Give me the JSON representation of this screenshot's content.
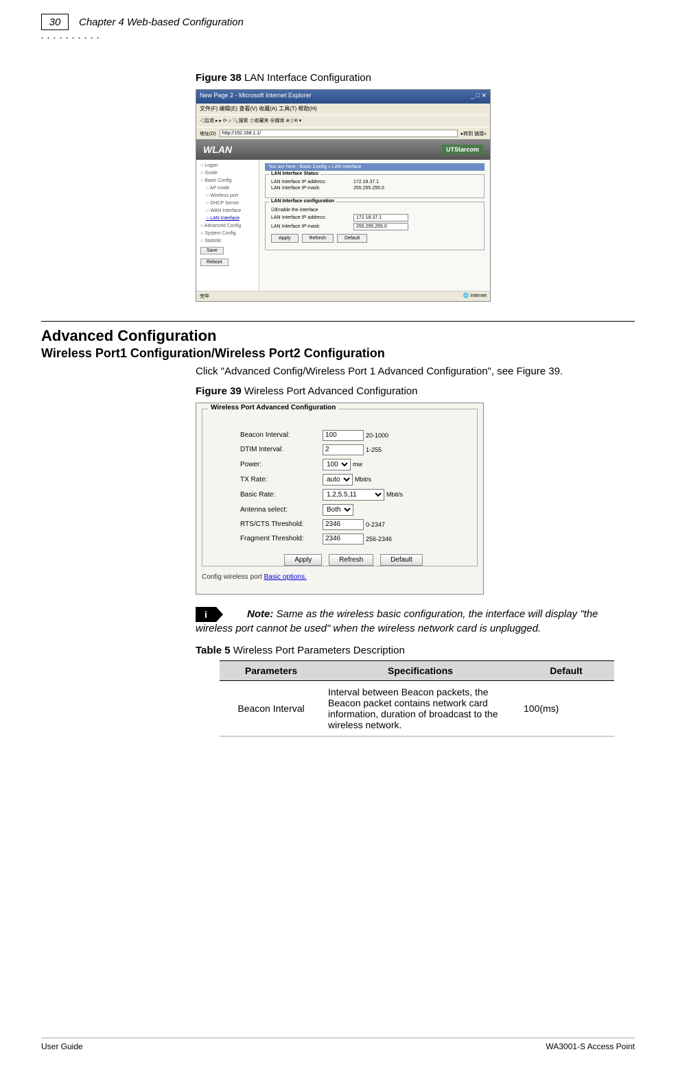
{
  "header": {
    "page_number": "30",
    "chapter_title": "Chapter 4 Web-based Configuration"
  },
  "figure38": {
    "title_prefix": "Figure 38",
    "title_text": " LAN Interface Configuration",
    "titlebar": "New Page 2 - Microsoft Internet Explorer",
    "menubar": "文件(F)  编辑(E)  查看(V)  收藏(A)  工具(T)  帮助(H)",
    "addr_label": "地址(D)",
    "addr_value": "http://192.168.1.1/",
    "wlan": "WLAN",
    "brand": "UTStarcom",
    "breadcrumb": "You are here : Basic Config » LAN Interface",
    "nav": {
      "logon": "Logon",
      "guide": "Guide",
      "basic": "Basic Config",
      "ap": "AP mode",
      "wireless": "Wireless port",
      "dhcp": "DHCP Server",
      "wan": "WAN Interface",
      "lan": "LAN Interface",
      "advanced": "Advanced Config",
      "system": "System Config",
      "statistic": "Statistic",
      "save": "Save",
      "reboot": "Reboot"
    },
    "status": {
      "legend": "LAN Interface Status",
      "ip_label": "LAN Interface IP address:",
      "ip_value": "172.18.37.1",
      "mask_label": "LAN Interface IP mask:",
      "mask_value": "255.255.255.0"
    },
    "config": {
      "legend": "LAN Interface configuration",
      "enable": "Enable the interface",
      "ip_label": "LAN Interface IP address:",
      "ip_value": "172.18.37.1",
      "mask_label": "LAN Interface IP mask:",
      "mask_value": "255.255.255.0",
      "apply": "Apply",
      "refresh": "Refresh",
      "default": "Default"
    },
    "statusbar_left": "完毕",
    "statusbar_right": "Internet"
  },
  "section": {
    "title": "Advanced Configuration",
    "subtitle": "Wireless Port1 Configuration/Wireless Port2 Configuration",
    "body": "Click \"Advanced Config/Wireless Port 1 Advanced Configuration\", see Figure 39."
  },
  "figure39": {
    "title_prefix": "Figure 39",
    "title_text": " Wireless Port Advanced Configuration",
    "legend": "Wireless Port Advanced Configuration",
    "rows": {
      "beacon_label": "Beacon Interval:",
      "beacon_value": "100",
      "beacon_unit": "20-1000",
      "dtim_label": "DTIM Interval:",
      "dtim_value": "2",
      "dtim_unit": "1-255",
      "power_label": "Power:",
      "power_value": "100",
      "power_unit": "mw",
      "txrate_label": "TX Rate:",
      "txrate_value": "auto",
      "txrate_unit": "Mbit/s",
      "basicrate_label": "Basic Rate:",
      "basicrate_value": "1,2,5.5,11",
      "basicrate_unit": "Mbit/s",
      "antenna_label": "Antenna select:",
      "antenna_value": "Both",
      "rtscts_label": "RTS/CTS Threshold:",
      "rtscts_value": "2346",
      "rtscts_unit": "0-2347",
      "frag_label": "Fragment Threshold:",
      "frag_value": "2346",
      "frag_unit": "256-2346"
    },
    "buttons": {
      "apply": "Apply",
      "refresh": "Refresh",
      "default": "Default"
    },
    "footer_text": "Config wireless port ",
    "footer_link": "Basic options."
  },
  "note": {
    "label": "Note:",
    "text": " Same as the wireless basic configuration, the interface will display \"the wireless port cannot be used\" when the wireless network card is unplugged."
  },
  "table5": {
    "title_prefix": "Table 5",
    "title_text": " Wireless Port Parameters Description",
    "headers": {
      "col1": "Parameters",
      "col2": "Specifications",
      "col3": "Default"
    },
    "row1": {
      "param": "Beacon Interval",
      "spec": "Interval between Beacon packets, the Beacon packet contains network card information, duration of broadcast to the wireless network.",
      "default": "100(ms)"
    }
  },
  "footer": {
    "left": "User Guide",
    "right": "WA3001-S Access Point"
  }
}
